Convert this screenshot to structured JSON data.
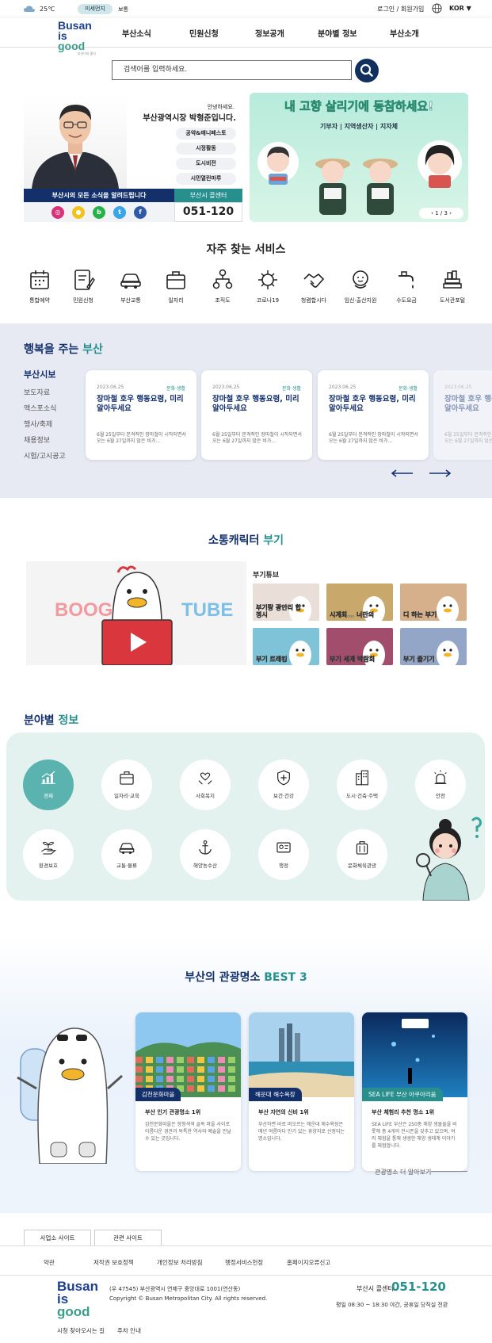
{
  "topbar": {
    "temperature": "25℃",
    "dust_badge": "미세먼지",
    "dust_value": "보통",
    "login": "로그인 / 회원가입",
    "language": "KOR ▼"
  },
  "logo": {
    "line1": "Busan",
    "line2_a": "is ",
    "line2_b": "good",
    "tagline": "부산이라 좋다"
  },
  "gnb": [
    "부산소식",
    "민원신청",
    "정보공개",
    "분야별 정보",
    "부산소개"
  ],
  "search": {
    "placeholder": "검색어를 입력하세요."
  },
  "mayor": {
    "greeting": "안녕하세요.",
    "name": "부산광역시장 박형준입니다.",
    "buttons": [
      "공약&매니페스토",
      "시정활동",
      "도시비전",
      "시민열린마루"
    ],
    "notice": "부산시의 모든 소식을 알려드립니다",
    "sns": [
      {
        "icon": "instagram-icon",
        "color": "#d6337a",
        "glyph": "◎"
      },
      {
        "icon": "kakao-icon",
        "color": "#f2c318",
        "glyph": "●"
      },
      {
        "icon": "blog-icon",
        "color": "#27b249",
        "glyph": "b"
      },
      {
        "icon": "twitter-icon",
        "color": "#3aa5e8",
        "glyph": "t"
      },
      {
        "icon": "facebook-icon",
        "color": "#2f5aa8",
        "glyph": "f"
      }
    ],
    "call_label": "부산시 콜센터",
    "call_number": "051-120"
  },
  "banner": {
    "title": "내 고향 살리기에 동참하세요!",
    "subtitle": "기부자 | 지역생산자 | 지자체",
    "pager": "‹  1 / 3  ›"
  },
  "services": {
    "title": "자주 찾는 서비스",
    "items": [
      {
        "label": "통합예약",
        "icon": "calendar-icon"
      },
      {
        "label": "민원신청",
        "icon": "document-pen-icon"
      },
      {
        "label": "부산교통",
        "icon": "car-icon"
      },
      {
        "label": "일자리",
        "icon": "briefcase-icon"
      },
      {
        "label": "조직도",
        "icon": "org-chart-icon"
      },
      {
        "label": "코로나19",
        "icon": "virus-icon"
      },
      {
        "label": "청렴합시다",
        "icon": "handshake-icon"
      },
      {
        "label": "임신·출산지원",
        "icon": "baby-icon"
      },
      {
        "label": "수도요금",
        "icon": "faucet-icon"
      },
      {
        "label": "도서관포털",
        "icon": "books-icon"
      }
    ]
  },
  "happy": {
    "title_a": "행복을 주는 ",
    "title_b": "부산",
    "tabs": [
      "부산시보",
      "보도자료",
      "액스포소식",
      "행사/축제",
      "채용정보",
      "시험/고시공고"
    ],
    "cards": [
      {
        "date": "2023.06.25",
        "cat": "문화·생활",
        "title": "장마철 호우 행동요령, 미리 알아두세요",
        "desc": "6월 25일부터 본격적인 장마철이 시작되면서 오는 6월 27일까지 많은 비가..."
      },
      {
        "date": "2023.06.25",
        "cat": "문화·생활",
        "title": "장마철 호우 행동요령, 미리 알아두세요",
        "desc": "6월 25일부터 본격적인 장마철이 시작되면서 오는 6월 27일까지 많은 비가..."
      },
      {
        "date": "2023.06.25",
        "cat": "문화·생활",
        "title": "장마철 호우 행동요령, 미리 알아두세요",
        "desc": "6월 25일부터 본격적인 장마철이 시작되면서 오는 6월 27일까지 많은 비가..."
      },
      {
        "date": "2023.06.25",
        "cat": "문화·생활",
        "title": "장마철 호우 행동요령, 미리 알아두세요",
        "desc": "6월 25일부터 본격적인 장마철이 시작되면서 오는 6월 27일까지 많은 비가..."
      }
    ]
  },
  "boogi": {
    "title_a": "소통캐릭터 ",
    "title_b": "부기",
    "banner_left": "BOOGI",
    "banner_right": "TUBE",
    "tube_label": "부기튜브",
    "thumbs": [
      {
        "text": "부기랑 광안리 합정시",
        "bg": "#e9ded8"
      },
      {
        "text": "시계최... 너만의",
        "bg": "#c9a86b"
      },
      {
        "text": "디 하는 부기",
        "bg": "#d6b08b"
      },
      {
        "text": "부기 트래킹",
        "bg": "#7fc3d8"
      },
      {
        "text": "부기 세계 박람회",
        "bg": "#a34d6d"
      },
      {
        "text": "부기 즐기기",
        "bg": "#93a6c8"
      }
    ]
  },
  "field": {
    "title_a": "분야별 ",
    "title_b": "정보",
    "items": [
      {
        "label": "경제",
        "icon": "growth-chart-icon",
        "active": true
      },
      {
        "label": "일자리·교육",
        "icon": "briefcase-icon",
        "active": false
      },
      {
        "label": "사회복지",
        "icon": "handshake-heart-icon",
        "active": false
      },
      {
        "label": "보건·건강",
        "icon": "health-shield-icon",
        "active": false
      },
      {
        "label": "도시·건축·주택",
        "icon": "building-icon",
        "active": false
      },
      {
        "label": "안전",
        "icon": "siren-icon",
        "active": false
      },
      {
        "label": "환경보호",
        "icon": "plant-hand-icon",
        "active": false
      },
      {
        "label": "교통·물류",
        "icon": "car-icon",
        "active": false
      },
      {
        "label": "해양농수산",
        "icon": "anchor-icon",
        "active": false
      },
      {
        "label": "행정",
        "icon": "id-card-icon",
        "active": false
      },
      {
        "label": "문화체육관광",
        "icon": "suitcase-icon",
        "active": false
      }
    ]
  },
  "tour": {
    "title_a": "부산의 관광명소 ",
    "title_b": "BEST 3",
    "cards": [
      {
        "tag": "감천문화마을",
        "rank": "부산 인기 관광명소 1위",
        "desc": "감천문화마을은 형형색색 골목 마을 사이로 아름다운 경관과 독특한 역사와 예술을 만날 수 있는 곳입니다.",
        "tag_color": "#13306b"
      },
      {
        "tag": "해운대 해수욕장",
        "rank": "부산 자연의 신비 1위",
        "desc": "부산하면 바로 떠오르는 해운대 해수욕장은 매년 여름마다 인기 있는 휴양지로 선정되는 명소입니다.",
        "tag_color": "#13306b"
      },
      {
        "tag": "SEA LIFE 부산 아쿠아리움",
        "rank": "부산 체험리 추천 명소 1위",
        "desc": "SEA LIFE 부산은 250종 해양 생물들을 비롯해 총 4개의 전시존을 갖추고 있으며, 여러 체험을 통해 생생한 해양 생태계 이야기를 체험합니다.",
        "tag_color": "#27908f"
      }
    ],
    "more": "관광명소 더 알아보기"
  },
  "footer": {
    "site_tabs": [
      "사업소 사이트",
      "관련 사이트"
    ],
    "links": [
      "약관",
      "저작권 보호정책",
      "개인정보 처리방침",
      "행정서비스헌장",
      "홈페이지오류신고"
    ],
    "address": "(우 47545) 부산광역시 연제구 중앙대로 1001(연산동)",
    "copyright": "Copyright © Busan Metropolitan City. All rights reserved.",
    "call_label": "부산시 콜센터",
    "call_number": "051-120",
    "hours": "평일 08:30 ~ 18:30 야간, 공휴일 당직실 전환",
    "bottom": [
      "시청 찾아오시는 길",
      "주차 안내"
    ]
  }
}
